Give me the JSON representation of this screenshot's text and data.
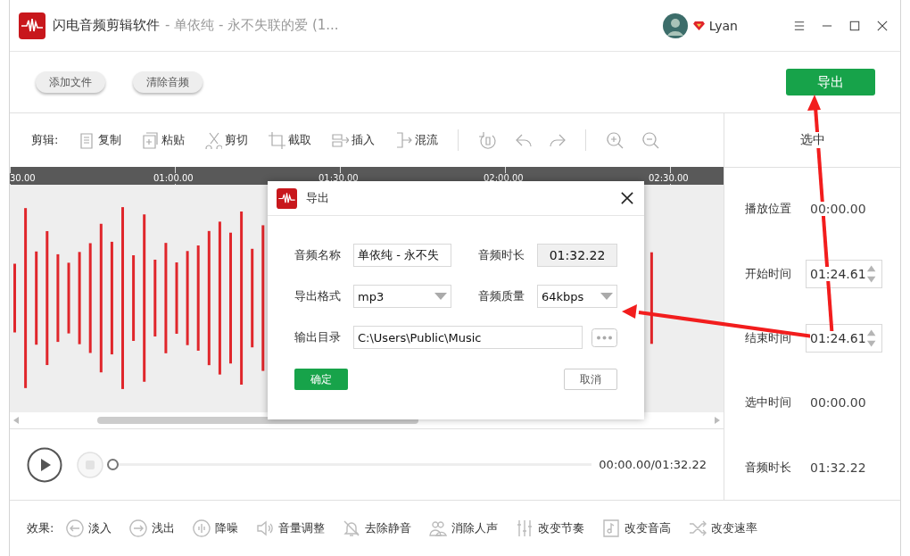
{
  "title_bar": {
    "app_name": "闪电音频剪辑软件",
    "separator": "-",
    "file_name": "单依纯 - 永不失联的爱 (1...",
    "user_name": "Lyan"
  },
  "toolbar": {
    "buttons": [
      "添加文件",
      "清除音频"
    ],
    "export_button": "导出"
  },
  "edit_toolbar": {
    "label": "剪辑:",
    "tools": [
      {
        "kind": "copy",
        "label": "复制"
      },
      {
        "kind": "paste",
        "label": "粘贴"
      },
      {
        "kind": "cut",
        "label": "剪切"
      },
      {
        "kind": "crop",
        "label": "截取"
      },
      {
        "kind": "insert",
        "label": "插入"
      },
      {
        "kind": "mix",
        "label": "混流"
      },
      {
        "kind": "separator"
      },
      {
        "kind": "loop"
      },
      {
        "kind": "undo"
      },
      {
        "kind": "redo"
      },
      {
        "kind": "separator"
      },
      {
        "kind": "zoom_in"
      },
      {
        "kind": "zoom_out"
      }
    ]
  },
  "timeline": {
    "ticks": [
      "30.00",
      "01:00.00",
      "01:30.00",
      "02:00.00",
      "02:30.00"
    ]
  },
  "player": {
    "time": "00:00.00/01:32.22",
    "level": 0,
    "stop_disabled": true
  },
  "selection_panel": {
    "title": "选中",
    "fields": [
      {
        "kind": "text",
        "label": "播放位置",
        "value": "00:00.00"
      },
      {
        "kind": "spinner",
        "label": "开始时间",
        "value": "01:24.61"
      },
      {
        "kind": "spinner",
        "label": "结束时间",
        "value": "01:24.61"
      },
      {
        "kind": "text",
        "label": "选中时间",
        "value": "00:00.00"
      },
      {
        "kind": "text",
        "label": "音频时长",
        "value": "01:32.22"
      }
    ]
  },
  "effects": {
    "label": "效果:",
    "items": [
      {
        "kind": "fade_in",
        "label": "淡入"
      },
      {
        "kind": "fade_out",
        "label": "浅出"
      },
      {
        "kind": "denoise",
        "label": "降噪"
      },
      {
        "kind": "volume",
        "label": "音量调整"
      },
      {
        "kind": "silence",
        "label": "去除静音"
      },
      {
        "kind": "vocal",
        "label": "消除人声"
      },
      {
        "kind": "tempo",
        "label": "改变节奏"
      },
      {
        "kind": "pitch",
        "label": "改变音高"
      },
      {
        "kind": "speed",
        "label": "改变速率"
      }
    ]
  },
  "dialog": {
    "title": "导出",
    "name_label": "音频名称",
    "name_value": "单依纯 - 永不失",
    "duration_label": "音频时长",
    "duration_value": "01:32.22",
    "format_label": "导出格式",
    "format_value": "mp3",
    "quality_label": "音频质量",
    "quality_value": "64kbps",
    "dir_label": "输出目录",
    "dir_value": "C:\\Users\\Public\\Music",
    "confirm": "确定",
    "cancel": "取消"
  }
}
